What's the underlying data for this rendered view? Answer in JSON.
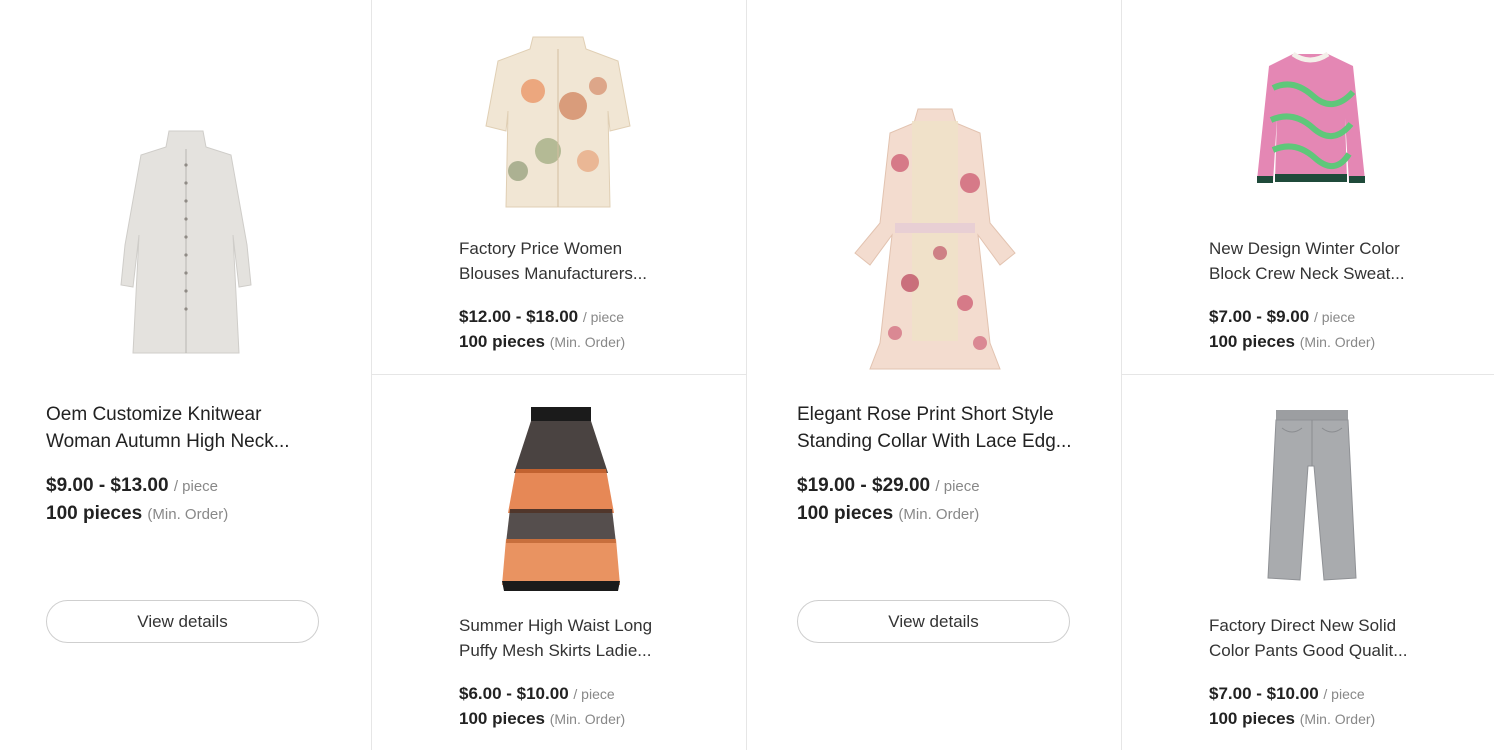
{
  "products": [
    {
      "title_line1": "Oem Customize Knitwear",
      "title_line2": "Woman Autumn High Neck...",
      "price": "$9.00 - $13.00",
      "price_unit": "/ piece",
      "moq": "100 pieces",
      "moq_note": "(Min. Order)",
      "button": "View details",
      "image": "white-knit-cardigan-dress"
    },
    {
      "title_line1": "Factory Price Women",
      "title_line2": "Blouses Manufacturers...",
      "price": "$12.00 - $18.00",
      "price_unit": "/ piece",
      "moq": "100 pieces",
      "moq_note": "(Min. Order)",
      "image": "floral-sheer-blouse"
    },
    {
      "title_line1": "Summer High Waist Long",
      "title_line2": "Puffy Mesh Skirts Ladie...",
      "price": "$6.00 - $10.00",
      "price_unit": "/ piece",
      "moq": "100 pieces",
      "moq_note": "(Min. Order)",
      "image": "orange-black-tulle-skirt"
    },
    {
      "title_line1": "Elegant Rose Print Short Style",
      "title_line2": "Standing Collar With Lace Edg...",
      "price": "$19.00 - $29.00",
      "price_unit": "/ piece",
      "moq": "100 pieces",
      "moq_note": "(Min. Order)",
      "button": "View details",
      "image": "rose-print-lace-dress"
    },
    {
      "title_line1": "New Design Winter Color",
      "title_line2": "Block Crew Neck Sweat...",
      "price": "$7.00 - $9.00",
      "price_unit": "/ piece",
      "moq": "100 pieces",
      "moq_note": "(Min. Order)",
      "image": "pink-green-sweater"
    },
    {
      "title_line1": "Factory Direct New Solid",
      "title_line2": "Color Pants Good Qualit...",
      "price": "$7.00 - $10.00",
      "price_unit": "/ piece",
      "moq": "100 pieces",
      "moq_note": "(Min. Order)",
      "image": "grey-straight-jeans"
    }
  ]
}
